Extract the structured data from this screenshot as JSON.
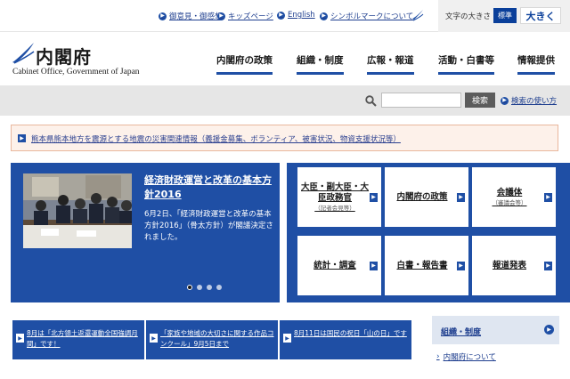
{
  "utility": {
    "links": [
      {
        "label": "御意見・御感想"
      },
      {
        "label": "キッズページ"
      },
      {
        "label": "English"
      },
      {
        "label": "シンボルマークについて"
      }
    ],
    "font_size_label": "文字の大きさ",
    "standard_label": "標準",
    "large_label": "大きく"
  },
  "header": {
    "title": "内閣府",
    "subtitle": "Cabinet Office, Government of Japan",
    "nav": [
      {
        "label": "内閣府の政策"
      },
      {
        "label": "組織・制度"
      },
      {
        "label": "広報・報道"
      },
      {
        "label": "活動・白書等"
      },
      {
        "label": "情報提供"
      }
    ]
  },
  "search": {
    "placeholder": "",
    "button_label": "検索",
    "help_label": "検索の使い方"
  },
  "alert": {
    "text": "熊本県熊本地方を震源とする地震の災害関連情報（義援金募集、ボランティア、被害状況、物資支援状況等）"
  },
  "hero": {
    "title": "経済財政運営と改革の基本方針2016",
    "body": "6月2日、「経済財政運営と改革の基本方針2016」（骨太方針）が閣議決定されました。",
    "prev_symbol": "‹",
    "next_symbol": "›",
    "slide_count": 4,
    "active_slide": 1
  },
  "tiles": [
    {
      "label": "大臣・副大臣・大臣政務官",
      "sub": "（記者会見等）"
    },
    {
      "label": "内閣府の政策",
      "sub": ""
    },
    {
      "label": "会議体",
      "sub": "（審議会等）"
    },
    {
      "label": "統計・調査",
      "sub": ""
    },
    {
      "label": "白書・報告書",
      "sub": ""
    },
    {
      "label": "報道発表",
      "sub": ""
    }
  ],
  "news": [
    {
      "text": "8月は「北方領土返還運動全国強調月間」です！"
    },
    {
      "text": "「家族や地域の大切さに関する作品コンクール」9月5日まで"
    },
    {
      "text": "8月11日は国民の祝日「山の日」です"
    }
  ],
  "side": {
    "panel_label": "組織・制度",
    "link_label": "内閣府について"
  },
  "colors": {
    "brand_blue": "#1f4fa5",
    "dark_blue": "#0a3f9a",
    "alert_bg": "#fdf1ea"
  }
}
